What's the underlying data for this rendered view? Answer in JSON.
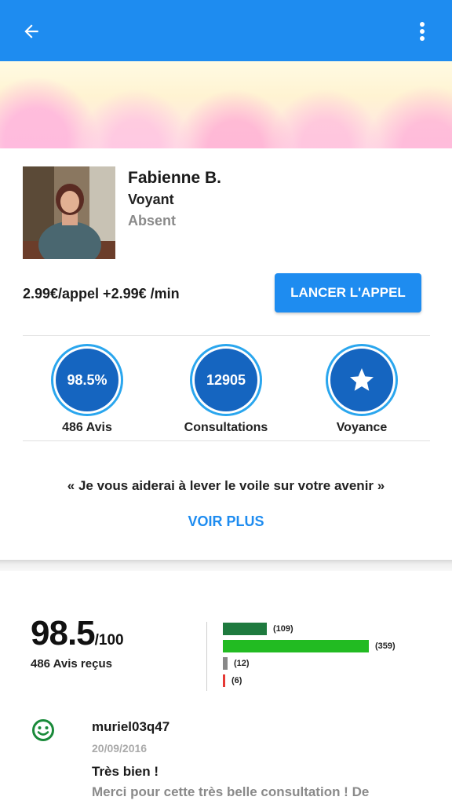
{
  "appbar": {
    "back_icon": "arrow-left-icon",
    "more_icon": "more-vertical-icon",
    "color": "#1e8cf0"
  },
  "profile": {
    "name": "Fabienne B.",
    "role": "Voyant",
    "status": "Absent",
    "price": "2.99€/appel +2.99€ /min",
    "call_button": "LANCER L'APPEL"
  },
  "stats": [
    {
      "value": "98.5%",
      "label": "486 Avis"
    },
    {
      "value": "12905",
      "label": "Consultations"
    },
    {
      "icon": "star-icon",
      "label": "Voyance"
    }
  ],
  "quote": "« Je vous aiderai à lever le voile sur votre avenir »",
  "voir_plus": "VOIR PLUS",
  "rating": {
    "score": "98.5",
    "out_of": "/100",
    "count_text": "486 Avis reçus",
    "bars": [
      {
        "count": 109,
        "label": "(109)",
        "color": "#1e7a3e"
      },
      {
        "count": 359,
        "label": "(359)",
        "color": "#22bb22"
      },
      {
        "count": 12,
        "label": "(12)",
        "color": "#888888"
      },
      {
        "count": 6,
        "label": "(6)",
        "color": "#e53935"
      }
    ]
  },
  "review": {
    "icon": "smiley-icon",
    "user": "muriel03q47",
    "date": "20/09/2016",
    "title": "Très bien !",
    "body": "Merci pour cette très belle consultation ! De"
  }
}
